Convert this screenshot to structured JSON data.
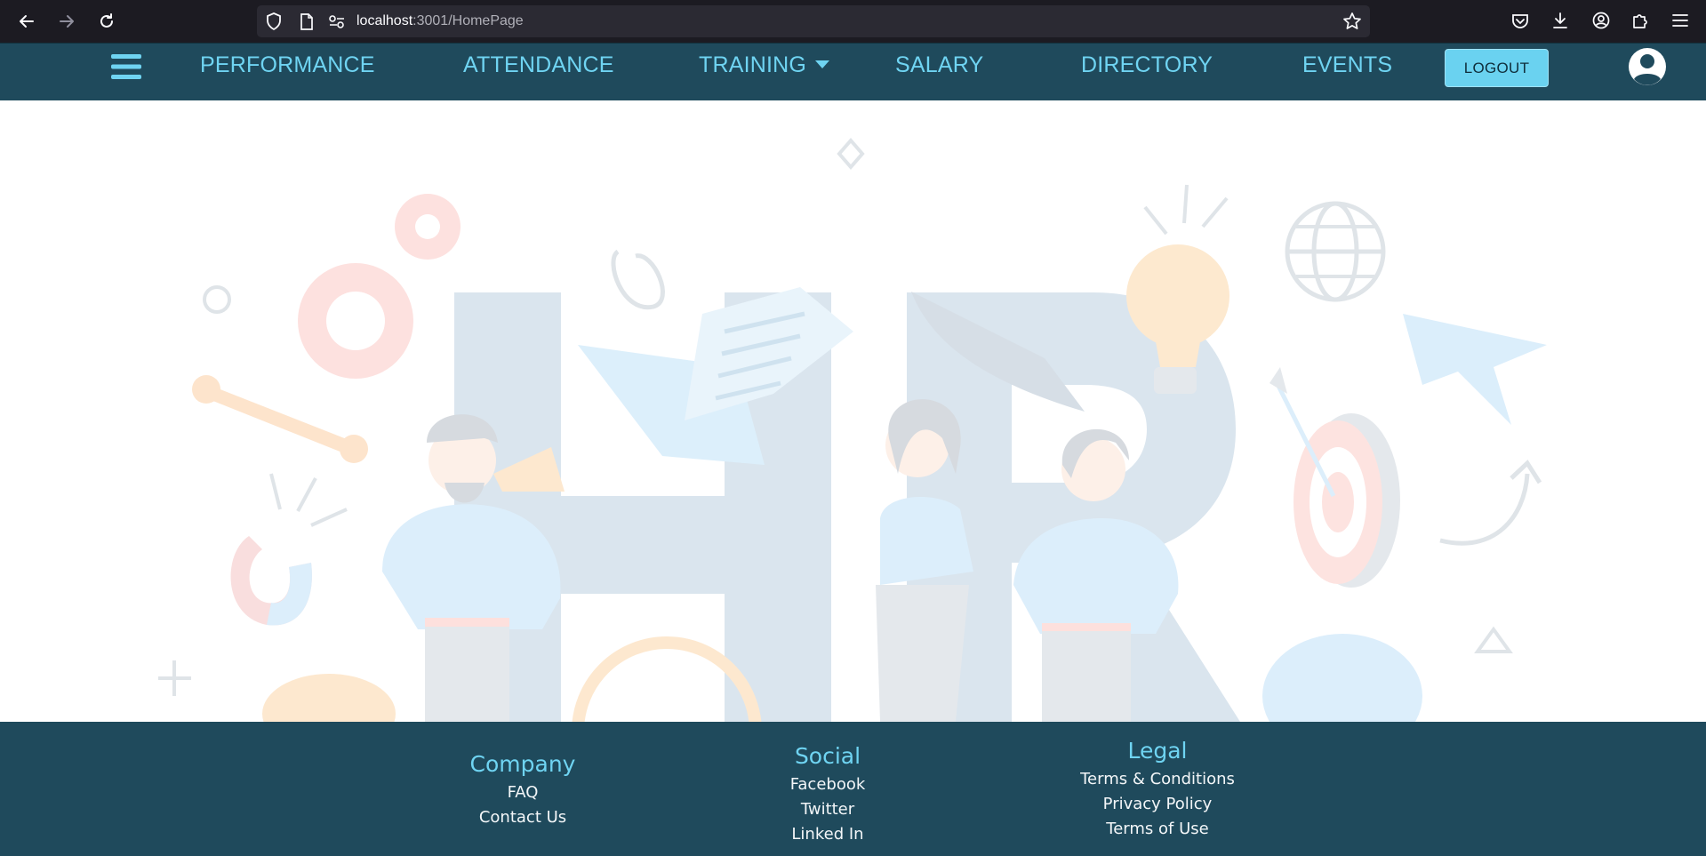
{
  "browser": {
    "url_host": "localhost",
    "url_path": ":3001/HomePage",
    "icons": [
      "back-icon",
      "forward-icon",
      "reload-icon",
      "shield-icon",
      "page-icon",
      "permissions-icon",
      "bookmark-star-icon",
      "pocket-icon",
      "download-icon",
      "account-icon",
      "extensions-icon",
      "menu-icon"
    ]
  },
  "nav": {
    "menu_icon": "hamburger-icon",
    "links": [
      "PERFORMANCE",
      "ATTENDANCE",
      "TRAINING",
      "SALARY",
      "DIRECTORY",
      "EVENTS"
    ],
    "logout_label": "LOGOUT",
    "profile_icon": "user-avatar-icon"
  },
  "hero": {
    "illustration": "hr-team-illustration"
  },
  "footer": {
    "company": {
      "heading": "Company",
      "links": [
        "FAQ",
        "Contact Us"
      ]
    },
    "social": {
      "heading": "Social",
      "links": [
        "Facebook",
        "Twitter",
        "Linked In"
      ]
    },
    "legal": {
      "heading": "Legal",
      "links": [
        "Terms & Conditions",
        "Privacy Policy",
        "Terms of Use"
      ]
    }
  },
  "colors": {
    "nav_bg": "#1f4a5c",
    "accent": "#6fd4f2",
    "browser_bg": "#1c1b22"
  }
}
